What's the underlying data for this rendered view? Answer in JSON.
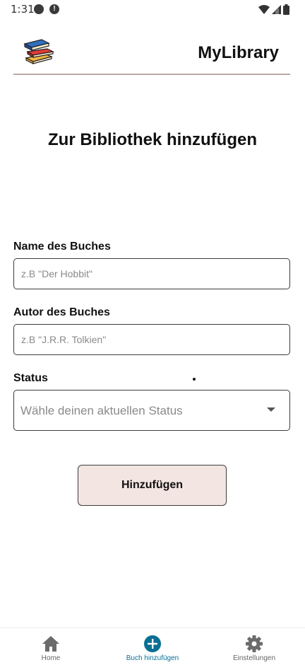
{
  "status_bar": {
    "time": "1:31"
  },
  "header": {
    "title": "MyLibrary"
  },
  "page": {
    "title": "Zur Bibliothek hinzufügen"
  },
  "form": {
    "name_label": "Name des Buches",
    "name_placeholder": "z.B \"Der Hobbit\"",
    "author_label": "Autor des Buches",
    "author_placeholder": "z.B \"J.R.R. Tolkien\"",
    "status_label": "Status",
    "status_placeholder": "Wähle deinen aktuellen Status",
    "submit_label": "Hinzufügen"
  },
  "bottom_nav": {
    "items": [
      {
        "label": "Home",
        "icon": "home-icon",
        "active": false
      },
      {
        "label": "Buch hinzufügen",
        "icon": "add-circle-icon",
        "active": true
      },
      {
        "label": "Einstellungen",
        "icon": "gear-icon",
        "active": false
      }
    ]
  },
  "colors": {
    "accent": "#0a6f93",
    "button_bg": "#f3e5e2",
    "header_divider": "#b9a9a4"
  }
}
